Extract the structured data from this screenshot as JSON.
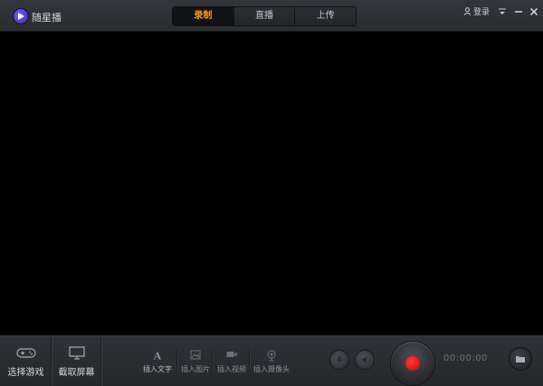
{
  "app": {
    "name": "随星播"
  },
  "tabs": [
    {
      "label": "录制",
      "active": true
    },
    {
      "label": "直播",
      "active": false
    },
    {
      "label": "上传",
      "active": false
    }
  ],
  "header": {
    "login_label": "登录"
  },
  "toolbar": {
    "select_game": "选择游戏",
    "capture_screen": "截取屏幕",
    "insert_text": "插入文字",
    "insert_image": "插入图片",
    "insert_video": "插入视频",
    "insert_camera": "插入摄像头",
    "timer": "00:00:00"
  },
  "colors": {
    "active_tab": "#ff9a1a",
    "record": "#e00000",
    "logo": "#6a4cf0"
  }
}
